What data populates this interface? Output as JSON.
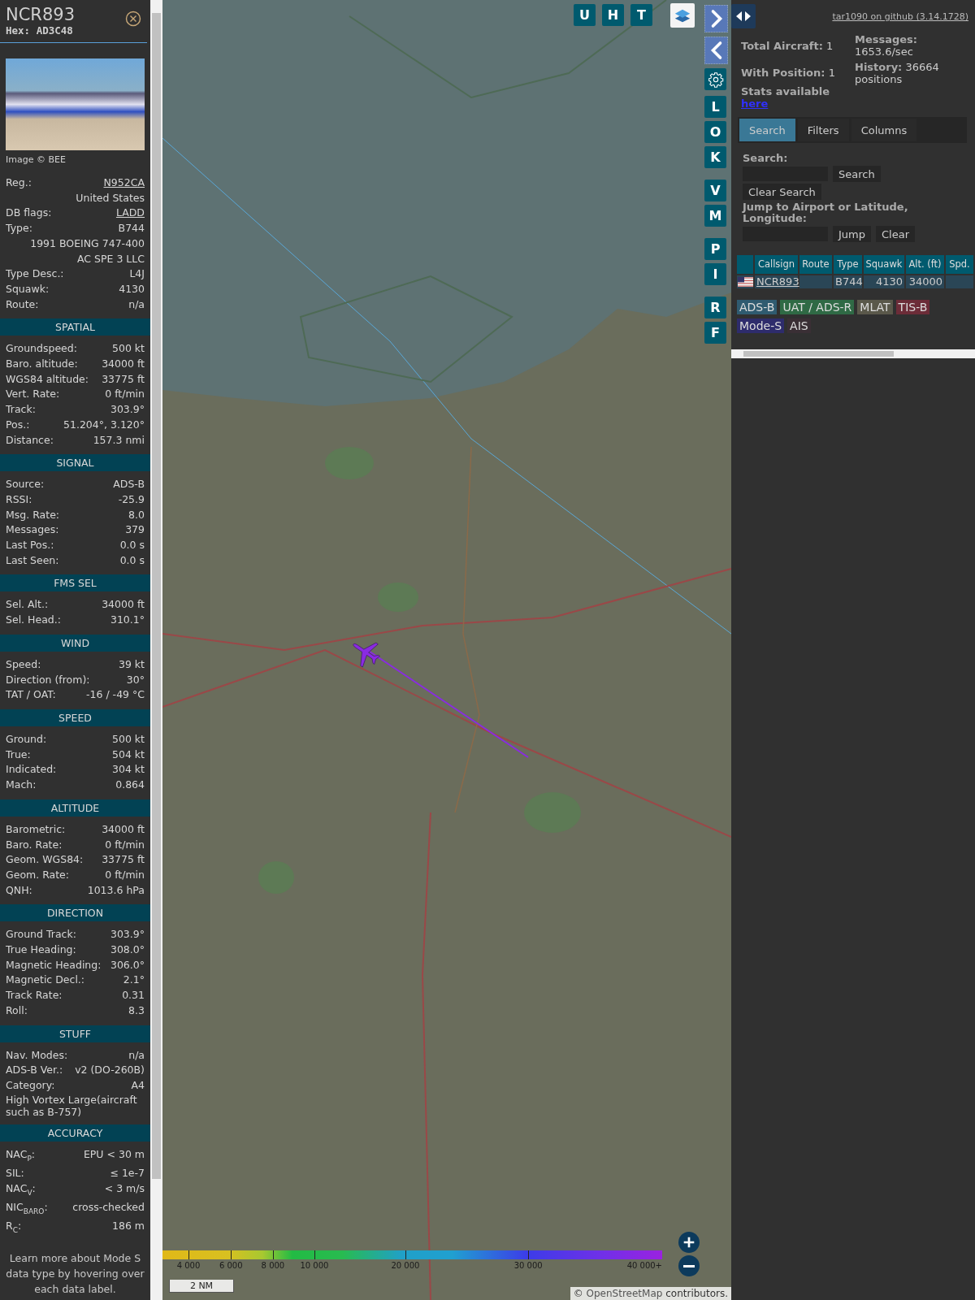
{
  "detail_panel": {
    "callsign": "NCR893",
    "hex": "Hex: AD3C48",
    "photo_credit": "Image © BEE",
    "sections": [
      {
        "rows": [
          {
            "kind": "link",
            "label": "Reg.:",
            "value": "N952CA"
          },
          {
            "kind": "value",
            "value": "United States"
          },
          {
            "kind": "link",
            "label": "DB flags:",
            "value": "LADD"
          },
          {
            "kind": "pair",
            "label": "Type:",
            "value": "B744"
          },
          {
            "kind": "value",
            "value": "1991 BOEING 747-400"
          },
          {
            "kind": "value",
            "value": "AC SPE 3 LLC"
          },
          {
            "kind": "pair",
            "label": "Type Desc.:",
            "value": "L4J"
          },
          {
            "kind": "pair",
            "label": "Squawk:",
            "value": "4130"
          },
          {
            "kind": "pair",
            "label": "Route:",
            "value": "n/a"
          }
        ]
      },
      {
        "title": "SPATIAL",
        "rows": [
          {
            "kind": "pair",
            "label": "Groundspeed:",
            "value": "500 kt"
          },
          {
            "kind": "pair",
            "label": "Baro. altitude:",
            "value": "34000 ft"
          },
          {
            "kind": "pair",
            "label": "WGS84 altitude:",
            "value": "33775 ft"
          },
          {
            "kind": "pair",
            "label": "Vert. Rate:",
            "value": "0 ft/min"
          },
          {
            "kind": "pair",
            "label": "Track:",
            "value": "303.9°"
          },
          {
            "kind": "pair",
            "label": "Pos.:",
            "value": "51.204°, 3.120°"
          },
          {
            "kind": "pair",
            "label": "Distance:",
            "value": "157.3 nmi"
          }
        ]
      },
      {
        "title": "SIGNAL",
        "rows": [
          {
            "kind": "pair",
            "label": "Source:",
            "value": "ADS-B"
          },
          {
            "kind": "pair",
            "label": "RSSI:",
            "value": "-25.9"
          },
          {
            "kind": "pair",
            "label": "Msg. Rate:",
            "value": "8.0"
          },
          {
            "kind": "pair",
            "label": "Messages:",
            "value": "379"
          },
          {
            "kind": "pair",
            "label": "Last Pos.:",
            "value": "0.0 s"
          },
          {
            "kind": "pair",
            "label": "Last Seen:",
            "value": "0.0 s"
          }
        ]
      },
      {
        "title": "FMS SEL",
        "rows": [
          {
            "kind": "pair",
            "label": "Sel. Alt.:",
            "value": "34000 ft"
          },
          {
            "kind": "pair",
            "label": "Sel. Head.:",
            "value": "310.1°"
          }
        ]
      },
      {
        "title": "WIND",
        "rows": [
          {
            "kind": "pair",
            "label": "Speed:",
            "value": "39 kt"
          },
          {
            "kind": "pair",
            "label": "Direction (from):",
            "value": "30°"
          },
          {
            "kind": "pair",
            "label": "TAT / OAT:",
            "value": "-16 / -49 °C"
          }
        ]
      },
      {
        "title": "SPEED",
        "rows": [
          {
            "kind": "pair",
            "label": "Ground:",
            "value": "500 kt"
          },
          {
            "kind": "pair",
            "label": "True:",
            "value": "504 kt"
          },
          {
            "kind": "pair",
            "label": "Indicated:",
            "value": "304 kt"
          },
          {
            "kind": "pair",
            "label": "Mach:",
            "value": "0.864"
          }
        ]
      },
      {
        "title": "ALTITUDE",
        "rows": [
          {
            "kind": "pair",
            "label": "Barometric:",
            "value": "34000 ft"
          },
          {
            "kind": "pair",
            "label": "Baro. Rate:",
            "value": "0 ft/min"
          },
          {
            "kind": "pair",
            "label": "Geom. WGS84:",
            "value": "33775 ft"
          },
          {
            "kind": "pair",
            "label": "Geom. Rate:",
            "value": "0 ft/min"
          },
          {
            "kind": "pair",
            "label": "QNH:",
            "value": "1013.6 hPa"
          }
        ]
      },
      {
        "title": "DIRECTION",
        "rows": [
          {
            "kind": "pair",
            "label": "Ground Track:",
            "value": "303.9°"
          },
          {
            "kind": "pair",
            "label": "True Heading:",
            "value": "308.0°"
          },
          {
            "kind": "pair",
            "label": "Magnetic Heading:",
            "value": "306.0°"
          },
          {
            "kind": "pair",
            "label": "Magnetic Decl.:",
            "value": "2.1°"
          },
          {
            "kind": "pair",
            "label": "Track Rate:",
            "value": "0.31"
          },
          {
            "kind": "pair",
            "label": "Roll:",
            "value": "8.3"
          }
        ]
      },
      {
        "title": "STUFF",
        "rows": [
          {
            "kind": "pair",
            "label": "Nav. Modes:",
            "value": "n/a"
          },
          {
            "kind": "pair",
            "label": "ADS-B Ver.:",
            "value": "v2 (DO-260B)"
          },
          {
            "kind": "pair",
            "label": "Category:",
            "value": "A4"
          },
          {
            "kind": "note",
            "value": "High Vortex Large(aircraft such as B-757)"
          }
        ]
      },
      {
        "title": "ACCURACY",
        "rows": [
          {
            "kind": "pair",
            "label": "NAC$_{P}$:",
            "value": "EPU < 30 m"
          },
          {
            "kind": "pair",
            "label": "SIL:",
            "value": "≤ 1e-7"
          },
          {
            "kind": "pair",
            "label": "NAC$_{V}$:",
            "value": "< 3 m/s"
          },
          {
            "kind": "pair",
            "label": "NIC$_{BARO}$:",
            "value": "cross-checked"
          },
          {
            "kind": "pair",
            "label": "R$_{C}$:",
            "value": "186 m"
          }
        ]
      }
    ],
    "footer": "Learn more about Mode S data type by hovering over each data label."
  },
  "map": {
    "top_buttons": [
      "U",
      "H",
      "T"
    ],
    "side_button_groups": [
      [
        "L",
        "O",
        "K"
      ],
      [
        "V",
        "M"
      ],
      [
        "P",
        "I"
      ],
      [
        "R",
        "F"
      ]
    ],
    "altitude_legend": [
      "4 000",
      "6 000",
      "8 000",
      "10 000",
      "20 000",
      "30 000",
      "40 000+"
    ],
    "scale": "2 NM",
    "attribution": {
      "prefix": "©",
      "link": "OpenStreetMap",
      "suffix": "contributors."
    }
  },
  "sidebar": {
    "github_link": "tar1090 on github (3.14.1728)",
    "stats_left": [
      "**Total Aircraft:** 1",
      "**With Position:** 1"
    ],
    "stats_right": [
      "**Messages:** 1653.6/sec",
      "**History:** 36664 positions"
    ],
    "stats_note": "Stats available",
    "stats_link": "here",
    "tabs": [
      {
        "label": "Search",
        "selected": true
      },
      {
        "label": "Filters",
        "selected": false
      },
      {
        "label": "Columns",
        "selected": false
      }
    ],
    "search": {
      "label": "Search:",
      "button": "Search",
      "clear_button": "Clear Search",
      "jump_label": "Jump to Airport or Latitude, Longitude:",
      "jump_button": "Jump",
      "jump_clear_button": "Clear"
    },
    "table": {
      "columns": [
        "Callsign",
        "Route",
        "Type",
        "Squawk",
        "Alt. (ft)",
        "Spd."
      ],
      "rows": [
        {
          "callsign": "NCR893",
          "type": "B744",
          "squawk": "4130",
          "altitude": "34000"
        }
      ]
    },
    "sources": [
      {
        "label": "ADS-B",
        "color": "#2f5b70"
      },
      {
        "label": "UAT / ADS-R",
        "color": "#2f6a45"
      },
      {
        "label": "MLAT",
        "color": "#5a584a"
      },
      {
        "label": "TIS-B",
        "color": "#6c2c38"
      },
      {
        "label": "Mode-S",
        "color": "#2e2c6c"
      },
      {
        "label": "AIS",
        "color": "#3a2f35"
      }
    ]
  }
}
